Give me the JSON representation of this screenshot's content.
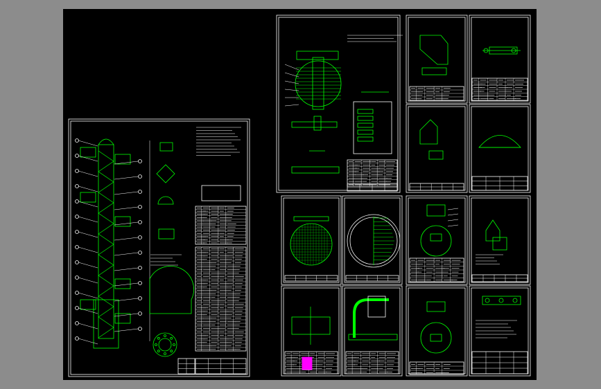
{
  "app": {
    "background_color": "#8c8c8c",
    "viewport_color": "#000000"
  },
  "drawing": {
    "colors": {
      "frame": "#ffffff",
      "geometry": "#00ff00",
      "annotation": "#ffffff",
      "table_fill": "#ffffff",
      "hatch": "#00ff00",
      "accent_magenta": "#ff00ff",
      "accent_cyan": "#00ffff",
      "accent_yellow": "#ffff00"
    },
    "sheets": [
      {
        "id": "assembly",
        "name": "sheet-assembly"
      },
      {
        "id": "tray-layout",
        "name": "sheet-tray-layout"
      },
      {
        "id": "detail-a1",
        "name": "sheet-detail-a1"
      },
      {
        "id": "detail-a2",
        "name": "sheet-detail-a2"
      },
      {
        "id": "detail-b1",
        "name": "sheet-detail-b1"
      },
      {
        "id": "detail-b2",
        "name": "sheet-detail-b2"
      },
      {
        "id": "grid-plate",
        "name": "sheet-grid-plate"
      },
      {
        "id": "tray-plate",
        "name": "sheet-tray-plate"
      },
      {
        "id": "detail-c1",
        "name": "sheet-detail-c1"
      },
      {
        "id": "detail-c2",
        "name": "sheet-detail-c2"
      },
      {
        "id": "pipe-section",
        "name": "sheet-pipe-section"
      },
      {
        "id": "elbow-pipe",
        "name": "sheet-elbow-pipe"
      },
      {
        "id": "detail-d1",
        "name": "sheet-detail-d1"
      },
      {
        "id": "detail-d2",
        "name": "sheet-detail-d2"
      }
    ]
  }
}
